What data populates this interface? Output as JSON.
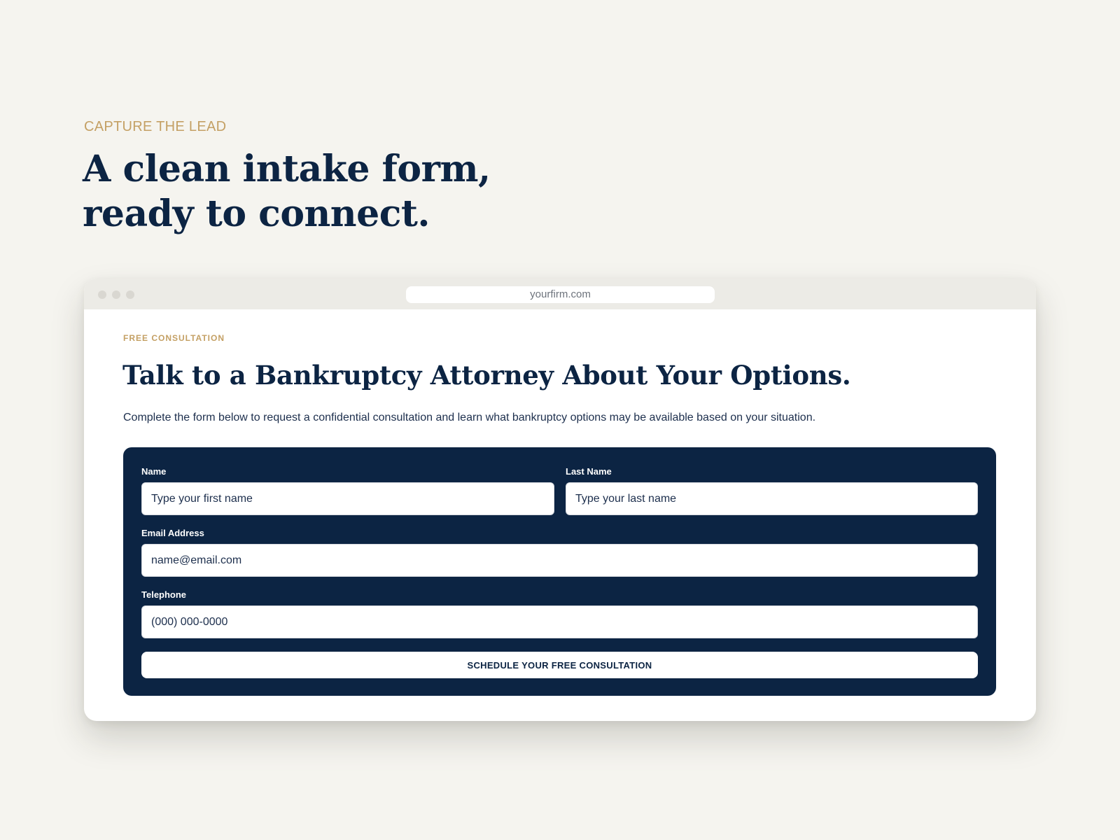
{
  "hero": {
    "eyebrow": "CAPTURE THE LEAD",
    "title_line1": "A clean intake form,",
    "title_line2": "ready to connect."
  },
  "browser": {
    "url": "yourfirm.com"
  },
  "page": {
    "eyebrow": "FREE CONSULTATION",
    "title": "Talk to a Bankruptcy Attorney About Your Options.",
    "description": "Complete the form below to request a confidential consultation and learn what bankruptcy options may be available based on your situation."
  },
  "form": {
    "first_name": {
      "label": "Name",
      "value": "",
      "placeholder": "Type your first name"
    },
    "last_name": {
      "label": "Last Name",
      "value": "",
      "placeholder": "Type your last name"
    },
    "email": {
      "label": "Email Address",
      "value": "",
      "placeholder": "name@email.com"
    },
    "telephone": {
      "label": "Telephone",
      "value": "",
      "placeholder": "(000) 000-0000"
    },
    "submit_label": "SCHEDULE YOUR FREE CONSULTATION"
  },
  "colors": {
    "background": "#f5f4ef",
    "navy": "#0c2443",
    "gold": "#c4a064",
    "browser_bar": "#ecebe6"
  }
}
